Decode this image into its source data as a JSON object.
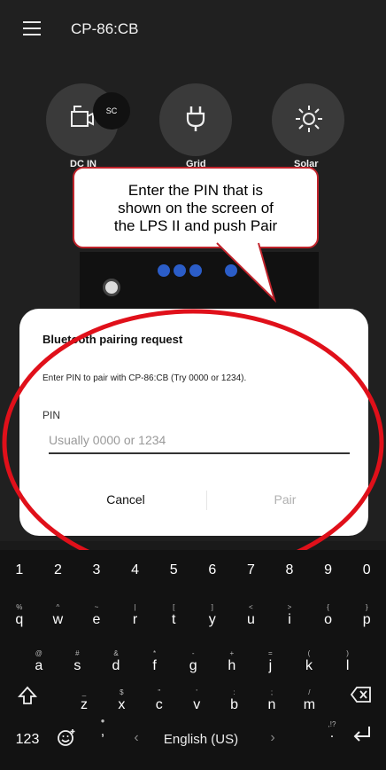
{
  "header": {
    "title": "CP-86:CB"
  },
  "sources": [
    {
      "label": "DC IN",
      "badge": "SC"
    },
    {
      "label": "Grid"
    },
    {
      "label": "Solar"
    }
  ],
  "callout": {
    "line1": "Enter the PIN that is",
    "line2": "shown on the screen of",
    "line3": "the LPS II and push Pair"
  },
  "dialog": {
    "title": "Bluetooth pairing request",
    "message": "Enter PIN to pair with CP-86:CB (Try 0000 or 1234).",
    "pin_label": "PIN",
    "pin_placeholder": "Usually 0000 or 1234",
    "cancel_label": "Cancel",
    "pair_label": "Pair"
  },
  "keyboard": {
    "numbers": [
      "1",
      "2",
      "3",
      "4",
      "5",
      "6",
      "7",
      "8",
      "9",
      "0"
    ],
    "row1": [
      [
        "q",
        "%"
      ],
      [
        "w",
        "^"
      ],
      [
        "e",
        "~"
      ],
      [
        "r",
        "|"
      ],
      [
        "t",
        "["
      ],
      [
        "y",
        "]"
      ],
      [
        "u",
        "<"
      ],
      [
        "i",
        ">"
      ],
      [
        "o",
        "{"
      ],
      [
        "p",
        "}"
      ]
    ],
    "row2": [
      [
        "a",
        "@"
      ],
      [
        "s",
        "#"
      ],
      [
        "d",
        "&"
      ],
      [
        "f",
        "*"
      ],
      [
        "g",
        "-"
      ],
      [
        "h",
        "+"
      ],
      [
        "j",
        "="
      ],
      [
        "k",
        "("
      ],
      [
        "l",
        ")"
      ]
    ],
    "row3": [
      [
        "z",
        "_"
      ],
      [
        "x",
        "$"
      ],
      [
        "c",
        "\""
      ],
      [
        "v",
        "'"
      ],
      [
        "b",
        ":"
      ],
      [
        "n",
        ";"
      ],
      [
        "m",
        "/"
      ]
    ],
    "symbols_label": "123",
    "comma": ",",
    "language": "English (US)",
    "period": ".",
    "period_sup": ",!?"
  },
  "colors": {
    "accent_red": "#e0101a",
    "callout_border": "#c0232b",
    "led_blue": "#2b5dc8"
  }
}
